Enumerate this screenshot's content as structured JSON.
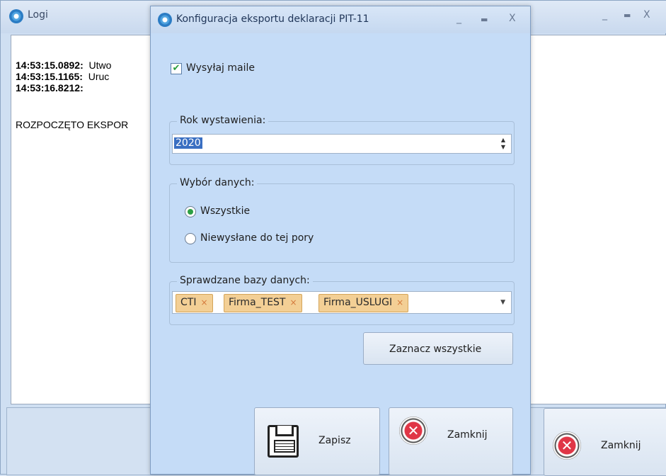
{
  "background_window": {
    "title": "Logi",
    "min_glyph": "_",
    "max_glyph": "▬",
    "close_glyph": "X",
    "log_lines": [
      {
        "time": "14:53:15.0892:",
        "text": "Utwo"
      },
      {
        "time": "14:53:15.1165:",
        "text": "Uruc"
      },
      {
        "time": "14:53:16.8212:",
        "text": ""
      }
    ],
    "export_message": "ROZPOCZĘTO EKSPOR",
    "close_button_label": "Zamknij"
  },
  "dialog": {
    "title": "Konfiguracja eksportu deklaracji PIT-11",
    "min_glyph": "_",
    "max_glyph": "▬",
    "close_glyph": "X",
    "send_mail": {
      "label": "Wysyłaj maile",
      "checked": true,
      "check_glyph": "✔"
    },
    "year_group": {
      "legend": "Rok wystawienia:",
      "value": "2020",
      "spin_up": "▲",
      "spin_down": "▼"
    },
    "data_group": {
      "legend": "Wybór danych:",
      "options": [
        {
          "label": "Wszystkie",
          "checked": true
        },
        {
          "label": "Niewysłane do tej pory",
          "checked": false
        }
      ]
    },
    "db_group": {
      "legend": "Sprawdzane bazy danych:",
      "tokens": [
        "CTI",
        "Firma_TEST",
        "Firma_USLUGI"
      ],
      "token_remove_glyph": "×",
      "dropdown_glyph": "▼"
    },
    "select_all_label": "Zaznacz wszystkie",
    "save_label": "Zapisz",
    "close_label": "Zamknij",
    "x_glyph": "✕"
  },
  "colors": {
    "dialog_bg": "#c5dcf7",
    "token_bg": "#f3cf95",
    "selection": "#3a6fc2",
    "close_icon_red": "#e03646"
  }
}
